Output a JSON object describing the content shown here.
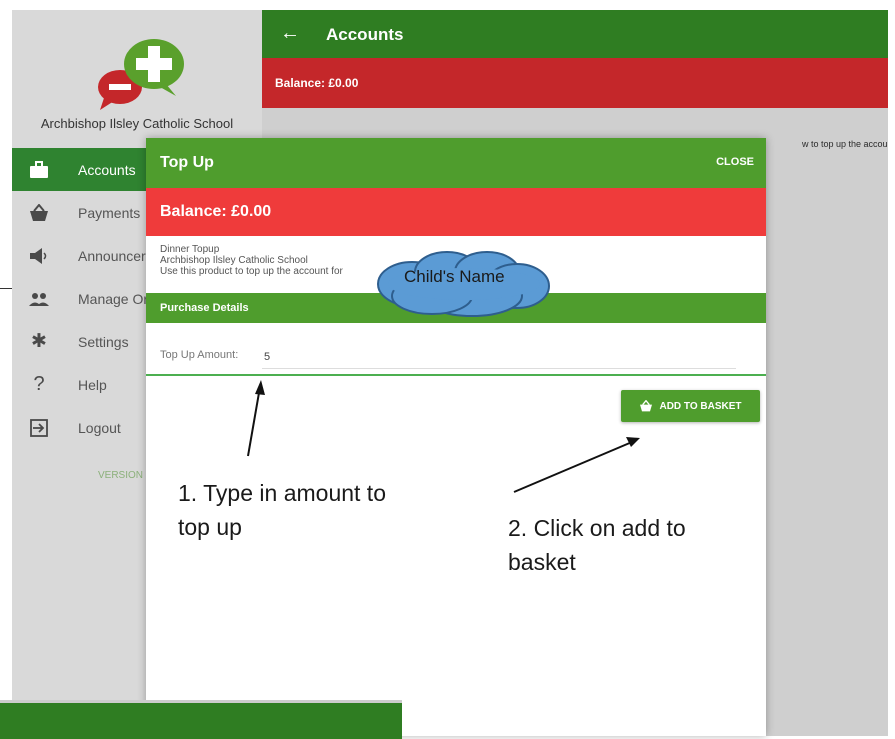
{
  "school_name": "Archbishop Ilsley Catholic School",
  "nav": [
    {
      "label": "Accounts",
      "icon": "briefcase-icon",
      "active": true
    },
    {
      "label": "Payments",
      "icon": "basket-icon"
    },
    {
      "label": "Announcer",
      "icon": "megaphone-icon"
    },
    {
      "label": "Manage Or",
      "icon": "people-icon"
    },
    {
      "label": "Settings",
      "icon": "gear-icon"
    },
    {
      "label": "Help",
      "icon": "help-icon"
    },
    {
      "label": "Logout",
      "icon": "logout-icon"
    }
  ],
  "version_label": "VERSION",
  "appbar": {
    "back_icon": "arrow-left-icon",
    "title": "Accounts"
  },
  "background_balance": "Balance: £0.00",
  "background_text": "w to top up the account:",
  "dialog": {
    "title": "Top Up",
    "close_label": "CLOSE",
    "balance": "Balance: £0.00",
    "product_name": "Dinner Topup",
    "product_school": "Archbishop Ilsley Catholic School",
    "product_desc": "Use this product to top up the account for",
    "section_title": "Purchase Details",
    "amount_label": "Top Up Amount:",
    "amount_value": "5",
    "add_button": "ADD TO BASKET"
  },
  "annotations": {
    "cloud_label": "Child's Name",
    "step1": "1. Type in amount to\ntop up",
    "step2": "2. Click on add to\nbasket"
  },
  "colors": {
    "dark_green": "#2f7d22",
    "green": "#4f9d2d",
    "red": "#ef3b3b",
    "dark_red": "#c4272a",
    "cloud_blue": "#5b9bd5"
  }
}
